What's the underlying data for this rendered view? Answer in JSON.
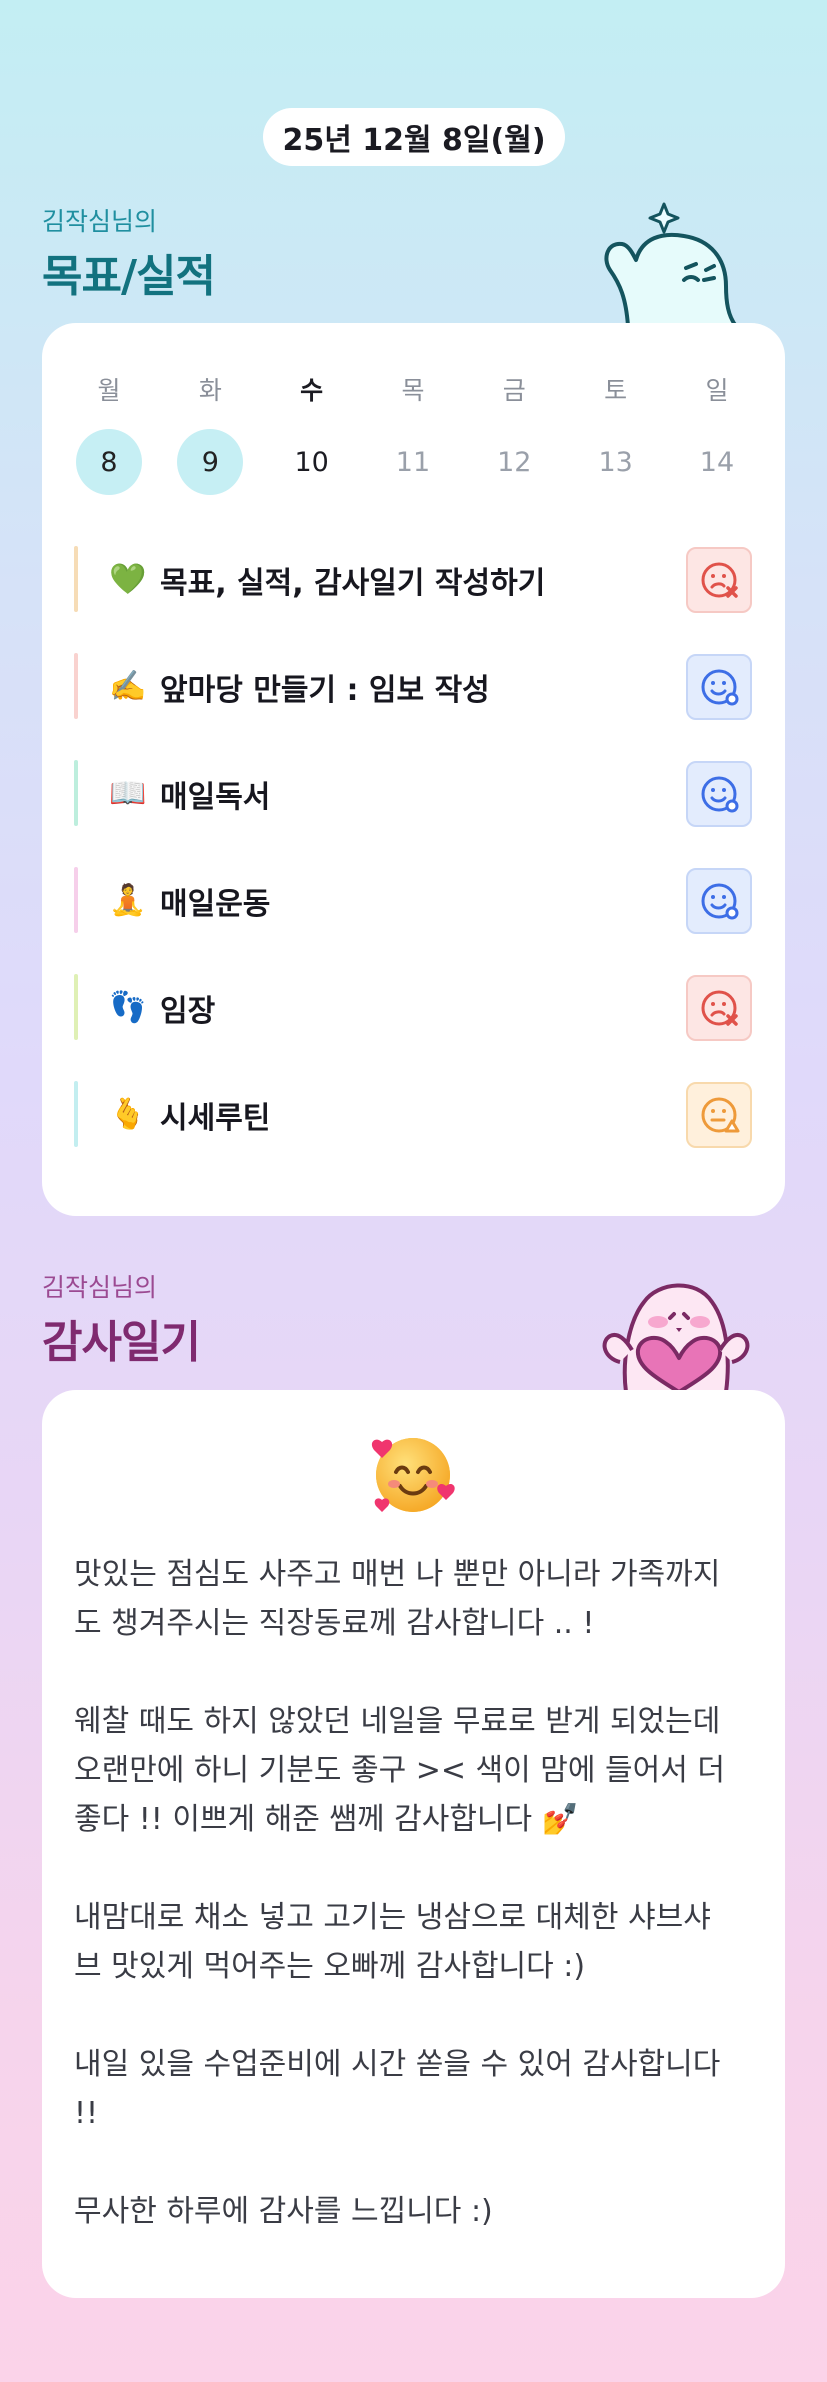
{
  "date": "25년 12월 8일(월)",
  "goals_section": {
    "owner": "김작심님의",
    "title": "목표/실적"
  },
  "week": [
    {
      "label": "월",
      "num": "8",
      "state": "past"
    },
    {
      "label": "화",
      "num": "9",
      "state": "past"
    },
    {
      "label": "수",
      "num": "10",
      "state": "today"
    },
    {
      "label": "목",
      "num": "11",
      "state": "future"
    },
    {
      "label": "금",
      "num": "12",
      "state": "future"
    },
    {
      "label": "토",
      "num": "13",
      "state": "future"
    },
    {
      "label": "일",
      "num": "14",
      "state": "future"
    }
  ],
  "goals": [
    {
      "emoji": "💚",
      "text": "목표, 실적, 감사일기 작성하기",
      "status": "fail",
      "bar_color": "#f6dcb6"
    },
    {
      "emoji": "✍️",
      "text": "앞마당 만들기 : 임보 작성",
      "status": "ok",
      "bar_color": "#f9d2cf"
    },
    {
      "emoji": "📖",
      "text": "매일독서",
      "status": "ok",
      "bar_color": "#bdeedd"
    },
    {
      "emoji": "🧘",
      "text": "매일운동",
      "status": "ok",
      "bar_color": "#f6cfea"
    },
    {
      "emoji": "👣",
      "text": "임장",
      "status": "fail",
      "bar_color": "#dff0b5"
    },
    {
      "emoji": "🫰",
      "text": "시세루틴",
      "status": "partial",
      "bar_color": "#c3eef0"
    }
  ],
  "gratitude_section": {
    "owner": "김작심님의",
    "title": "감사일기"
  },
  "gratitude_entries": [
    "맛있는 점심도 사주고 매번 나 뿐만 아니라 가족까지\n도 챙겨주시는 직장동료께 감사합니다 .. !",
    "웨찰 때도 하지 않았던 네일을 무료로 받게 되었는데\n오랜만에 하니 기분도 좋구 >< 색이 맘에 들어서 더\n좋다 !! 이쁘게 해준 쌤께 감사합니다 💅",
    "내맘대로 채소 넣고 고기는 냉삼으로 대체한 샤브샤\n브 맛있게 먹어주는 오빠께 감사합니다 :)",
    "내일 있을 수업준비에 시간 쏟을 수 있어 감사합니다\n!!",
    "무사한 하루에 감사를 느낍니다 :)"
  ],
  "colors": {
    "fail": "#e0524a",
    "ok": "#3d6ee6",
    "partial": "#ee9a3a",
    "past_day": "#c6eff4"
  }
}
